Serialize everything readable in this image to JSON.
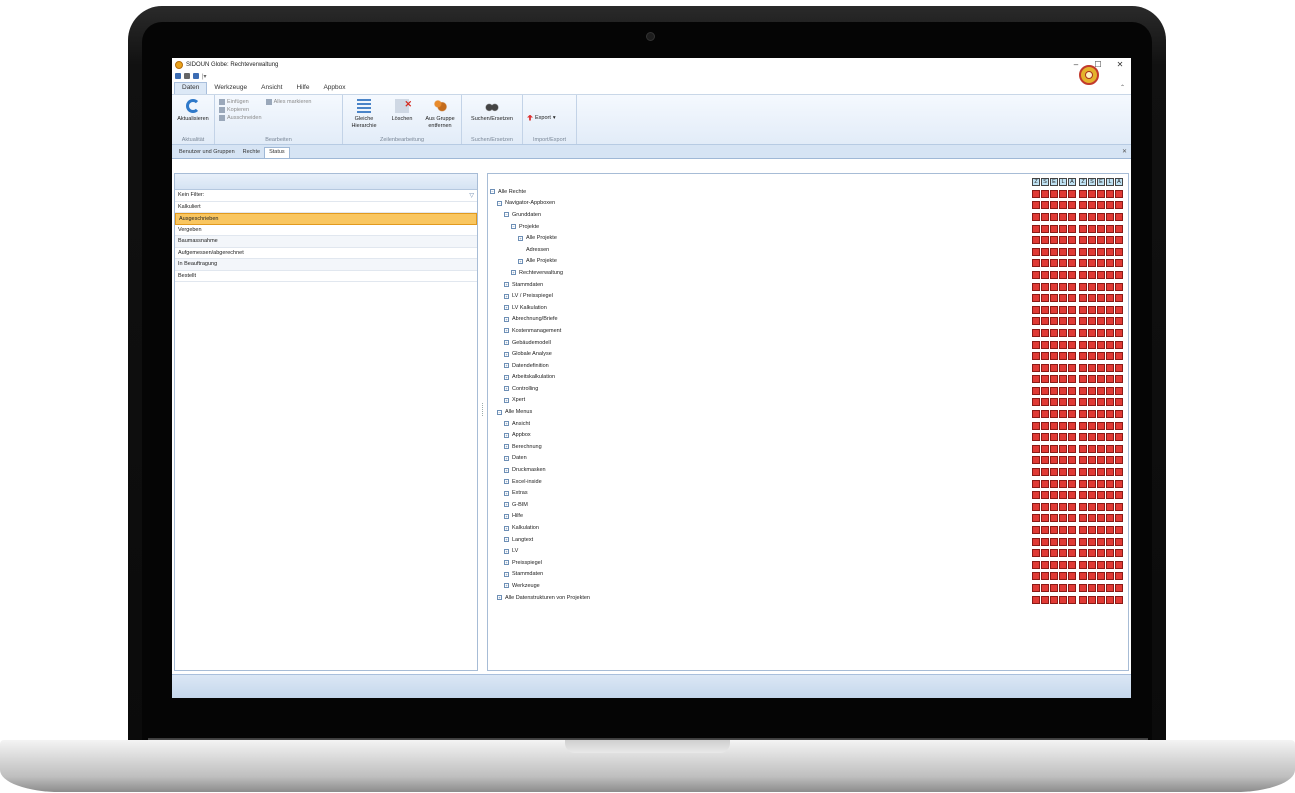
{
  "window": {
    "title": "SIDOUN Globe: Rechteverwaltung",
    "controls": [
      "–",
      "☐",
      "✕"
    ]
  },
  "menu": {
    "tabs": [
      "Daten",
      "Werkzeuge",
      "Ansicht",
      "Hilfe",
      "Appbox"
    ],
    "active": "Daten"
  },
  "ribbon": {
    "aktualitaet": {
      "refresh_label": "Aktualisieren",
      "group_label": "Aktualität"
    },
    "bearbeiten": {
      "einfuegen": "Einfügen",
      "alles_markieren": "Alles markieren",
      "kopieren": "Kopieren",
      "ausschneiden": "Ausschneiden",
      "group_label": "Bearbeiten"
    },
    "zeilenbearbeitung": {
      "gleiche_hierarchie": "Gleiche Hierarchie",
      "loeschen": "Löschen",
      "aus_gruppe_entfernen": "Aus Gruppe entfernen",
      "group_label": "Zeilenbearbeitung"
    },
    "suchen": {
      "label": "Suchen/Ersetzen",
      "group_label": "Suchen/Ersetzen"
    },
    "export": {
      "label": "Export",
      "group_label": "Import/Export"
    }
  },
  "doc_tabs": [
    "Benutzer und Gruppen",
    "Rechte",
    "Status"
  ],
  "doc_tab_active": "Status",
  "left_list": {
    "filter_row": "Kein Filter:",
    "items": [
      "Kalkuliert",
      "Ausgeschrieben",
      "Vergeben",
      "Baumassnahme",
      "Aufgemessen/abgerechnet",
      "In Beauftragung",
      "Bestellt"
    ],
    "selected": "Ausgeschrieben"
  },
  "tree": {
    "nodes": [
      {
        "label": "Alle Rechte",
        "level": 0,
        "expander": "⊟"
      },
      {
        "label": "Navigator-Appboxen",
        "level": 1,
        "expander": "⊟"
      },
      {
        "label": "Grunddaten",
        "level": 2,
        "expander": "⊟"
      },
      {
        "label": "Projekte",
        "level": 3,
        "expander": "⊟"
      },
      {
        "label": "Alle Projekte",
        "level": 4,
        "expander": "⊞"
      },
      {
        "label": "Adressen",
        "level": 4,
        "expander": ""
      },
      {
        "label": "Alle Projekte",
        "level": 4,
        "expander": "⊞"
      },
      {
        "label": "Rechteverwaltung",
        "level": 3,
        "expander": "⊞"
      },
      {
        "label": "Stammdaten",
        "level": 2,
        "expander": "⊞"
      },
      {
        "label": "LV / Preisspiegel",
        "level": 2,
        "expander": "⊞"
      },
      {
        "label": "LV Kalkulation",
        "level": 2,
        "expander": "⊞"
      },
      {
        "label": "Abrechnung/Briefe",
        "level": 2,
        "expander": "⊞"
      },
      {
        "label": "Kostenmanagement",
        "level": 2,
        "expander": "⊞"
      },
      {
        "label": "Gebäudemodell",
        "level": 2,
        "expander": "⊞"
      },
      {
        "label": "Globale Analyse",
        "level": 2,
        "expander": "⊞"
      },
      {
        "label": "Datendefinition",
        "level": 2,
        "expander": "⊞"
      },
      {
        "label": "Arbeitskalkulation",
        "level": 2,
        "expander": "⊞"
      },
      {
        "label": "Controlling",
        "level": 2,
        "expander": "⊞"
      },
      {
        "label": "Xpert",
        "level": 2,
        "expander": "⊞"
      },
      {
        "label": "Alle Menus",
        "level": 1,
        "expander": "⊟"
      },
      {
        "label": "Ansicht",
        "level": 2,
        "expander": "⊞"
      },
      {
        "label": "Appbox",
        "level": 2,
        "expander": "⊞"
      },
      {
        "label": "Berechnung",
        "level": 2,
        "expander": "⊞"
      },
      {
        "label": "Daten",
        "level": 2,
        "expander": "⊞"
      },
      {
        "label": "Druckmasken",
        "level": 2,
        "expander": "⊞"
      },
      {
        "label": "Excel-inside",
        "level": 2,
        "expander": "⊞"
      },
      {
        "label": "Extras",
        "level": 2,
        "expander": "⊞"
      },
      {
        "label": "G-BIM",
        "level": 2,
        "expander": "⊞"
      },
      {
        "label": "Hilfe",
        "level": 2,
        "expander": "⊞"
      },
      {
        "label": "Kalkulation",
        "level": 2,
        "expander": "⊞"
      },
      {
        "label": "Langtext",
        "level": 2,
        "expander": "⊞"
      },
      {
        "label": "LV",
        "level": 2,
        "expander": "⊞"
      },
      {
        "label": "Preisspiegel",
        "level": 2,
        "expander": "⊞"
      },
      {
        "label": "Stammdaten",
        "level": 2,
        "expander": "⊞"
      },
      {
        "label": "Werkzeuge",
        "level": 2,
        "expander": "⊞"
      },
      {
        "label": "Alle Datenstrukturen von Projekten",
        "level": 1,
        "expander": "⊞"
      }
    ]
  },
  "permission_grid": {
    "headers": [
      "Z",
      "S",
      "E",
      "L",
      "A",
      "Z",
      "S",
      "E",
      "L",
      "A"
    ],
    "cell_color": "#e03a35"
  },
  "colors": {
    "selection": "#f9c660",
    "ribbon_bg": "#e2ecf8",
    "header_cell": "#bfe2f3"
  }
}
